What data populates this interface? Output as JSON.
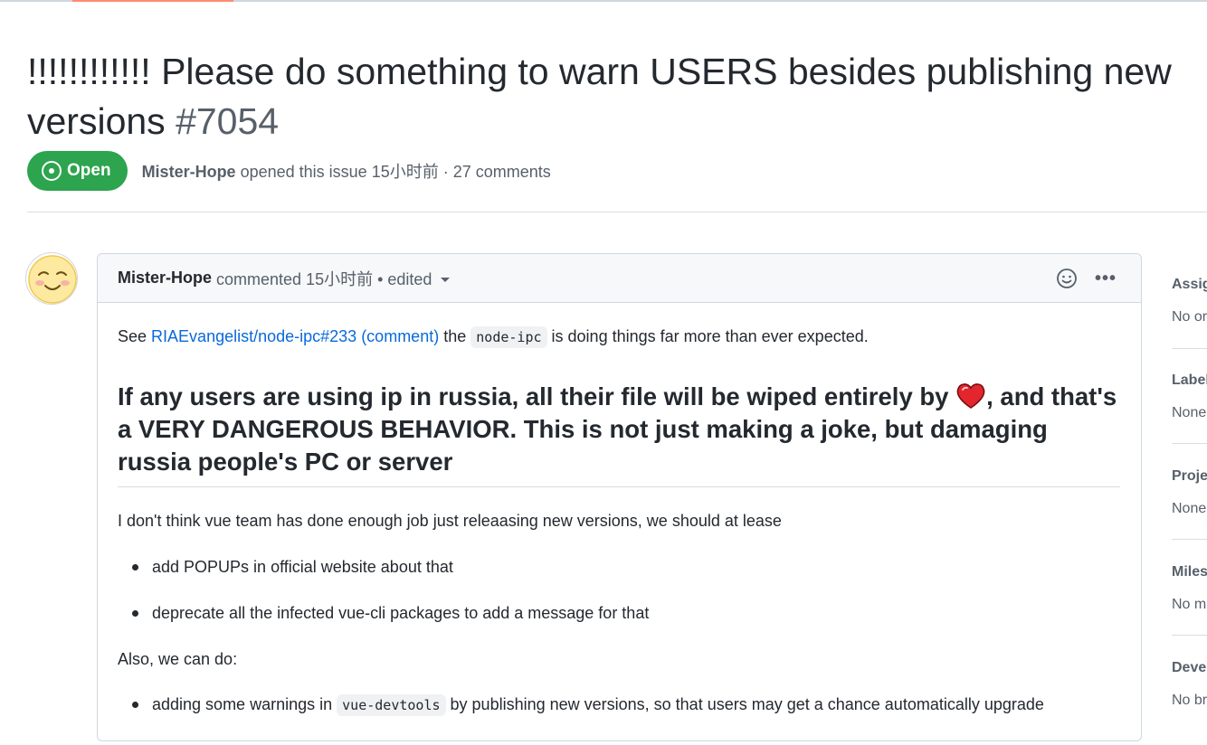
{
  "issue": {
    "title_line1": "!!!!!!!!!!!! Please do something to warn USERS besides publishing new",
    "title_line2": "versions",
    "number": "#7054",
    "state": "Open",
    "author": "Mister-Hope",
    "opened_text": "opened this issue 15小时前 · 27 comments"
  },
  "comment": {
    "author": "Mister-Hope",
    "meta": "commented 15小时前 • edited",
    "intro_prefix": "See",
    "link_text": "RIAEvangelist/node-ipc#233 (comment)",
    "intro_the": "the",
    "code1": "node-ipc",
    "intro_suffix": "is doing things far more than ever expected.",
    "heading_part1": "If any users are using ip in russia, all their file will be wiped entirely by",
    "heading_part2": ", and that's a VERY DANGEROUS BEHAVIOR. This is not just making a joke, but damaging russia people's PC or server",
    "para1": "I don't think vue team has done enough job just releaasing new versions, we should at lease",
    "bullet1": "add POPUPs in official website about that",
    "bullet2": "deprecate all the infected vue-cli packages to add a message for that",
    "para2": "Also, we can do:",
    "bullet3_prefix": "adding some warnings in",
    "code2": "vue-devtools",
    "bullet3_suffix": "by publishing new versions, so that users may get a chance automatically upgrade"
  },
  "sidebar": {
    "sections": [
      {
        "title": "Assig",
        "value": "No or"
      },
      {
        "title": "Label",
        "value": "None"
      },
      {
        "title": "Proje",
        "value": "None"
      },
      {
        "title": "Miles",
        "value": "No m"
      },
      {
        "title": "Devel",
        "value": "No br"
      }
    ]
  },
  "colors": {
    "open_badge": "#2da44e",
    "link": "#0969da",
    "tab_accent": "#fd8c73"
  }
}
